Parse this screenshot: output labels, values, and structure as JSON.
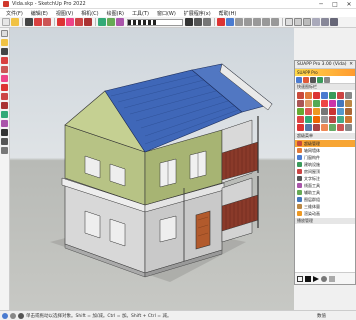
{
  "window": {
    "title": "Vida.skp - SketchUp Pro 2022",
    "minimize": "─",
    "maximize": "□",
    "close": "✕"
  },
  "menubar": {
    "items": [
      "文件(F)",
      "编辑(E)",
      "视图(V)",
      "相机(C)",
      "绘图(R)",
      "工具(T)",
      "窗口(W)",
      "扩展程序(x)",
      "帮助(H)"
    ]
  },
  "toolbar": {
    "scale_value": 0.55
  },
  "panel": {
    "title": "SUAPP Pro 3.00 (Vida)",
    "close": "✕",
    "subtitle": "SUAPP Pro",
    "section_icons_label": "快速图标栏",
    "section_menu_label": "超级菜单",
    "menu_items": [
      {
        "label": "超级管理",
        "selected": true
      },
      {
        "label": "轴网墙体",
        "selected": false
      },
      {
        "label": "门窗构件",
        "selected": false
      },
      {
        "label": "建筑设施",
        "selected": false
      },
      {
        "label": "房间屋顶",
        "selected": false
      },
      {
        "label": "文字标注",
        "selected": false
      },
      {
        "label": "线面工具",
        "selected": false
      },
      {
        "label": "辅助工具",
        "selected": false
      },
      {
        "label": "图层群组",
        "selected": false
      },
      {
        "label": "三维体量",
        "selected": false
      },
      {
        "label": "渲染动画",
        "selected": false
      }
    ],
    "section_bottom_label": "播放管理"
  },
  "status": {
    "text": "单击或拖动以选择对象。Shift = 加/减。Ctrl = 加。Shift + Ctrl = 减。",
    "measure_label": "数值"
  },
  "colors": {
    "roof": "#3f67b8",
    "upper_wall": "#a9b873",
    "lower_wall": "#d4d4d4",
    "railing": "#8a3a2a",
    "door": "#b25a2c",
    "selected_menu": "#f7a534"
  }
}
